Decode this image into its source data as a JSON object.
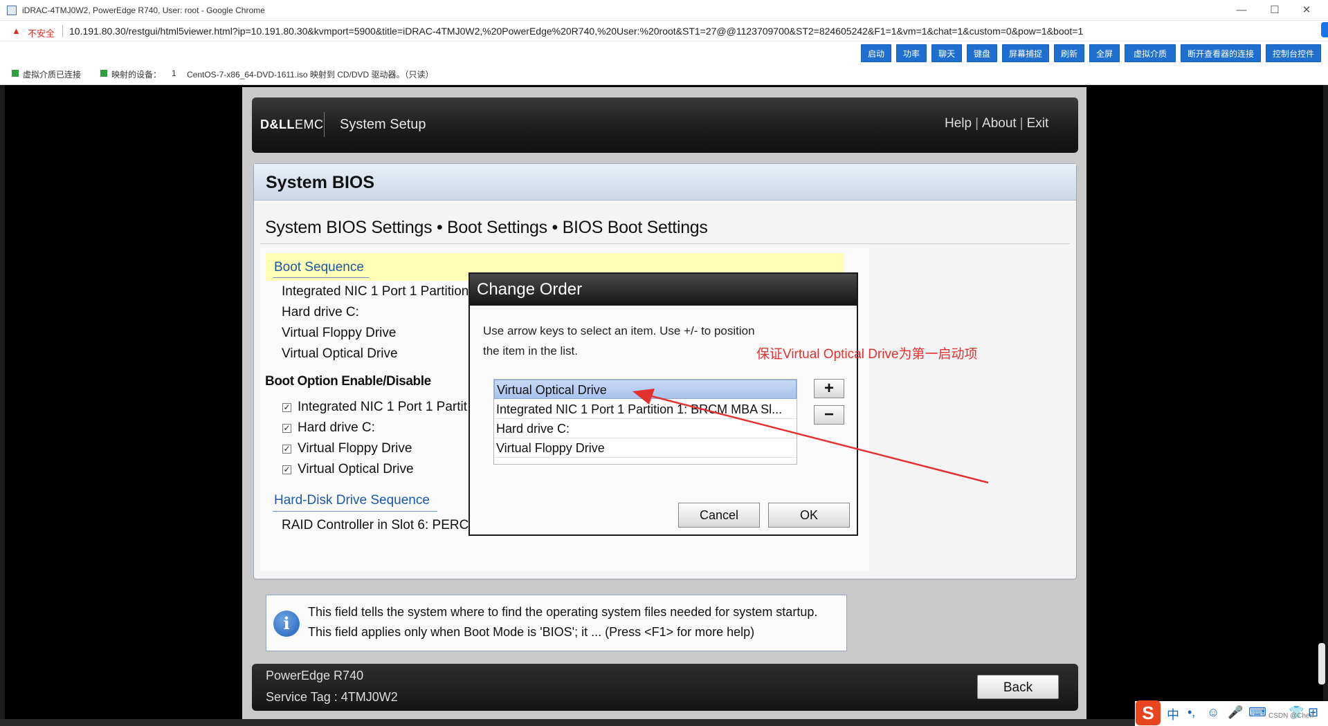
{
  "browser": {
    "window_title": "iDRAC-4TMJ0W2, PowerEdge R740, User: root - Google Chrome",
    "insecure_label": "不安全",
    "url": "10.191.80.30/restgui/html5viewer.html?ip=10.191.80.30&kvmport=5900&title=iDRAC-4TMJ0W2,%20PowerEdge%20R740,%20User:%20root&ST1=27@@1123709700&ST2=824605242&F1=1&vm=1&chat=1&custom=0&pow=1&boot=1",
    "minimize": "—",
    "maximize": "☐",
    "close": "✕"
  },
  "toolbar": {
    "buttons": [
      "启动",
      "功率",
      "聊天",
      "键盘",
      "屏幕捕捉",
      "刷新",
      "全屏",
      "虚拟介质",
      "断开查看器的连接",
      "控制台控件"
    ]
  },
  "status": {
    "vm_connected": "虚拟介质已连接",
    "mapped_label": "映射的设备：",
    "mapped_count": "1",
    "mapped_detail": "CentOS-7-x86_64-DVD-1611.iso 映射到 CD/DVD 驱动器。（只读）",
    "accent": "#2e9e3e"
  },
  "header": {
    "logo_bold": "D&LL",
    "logo_light": "EMC",
    "title": "System Setup",
    "links": [
      "Help",
      "About",
      "Exit"
    ]
  },
  "page": {
    "title": "System BIOS",
    "breadcrumb": "System BIOS Settings • Boot Settings • BIOS Boot Settings"
  },
  "boot_sequence": {
    "label": "Boot Sequence",
    "items": [
      "Integrated NIC 1 Port 1 Partition",
      "Hard drive C:",
      "Virtual Floppy Drive",
      "Virtual Optical Drive"
    ]
  },
  "boot_option": {
    "title": "Boot Option Enable/Disable",
    "items": [
      {
        "label": "Integrated NIC 1 Port 1 Partit",
        "checked": true
      },
      {
        "label": "Hard drive C:",
        "checked": true
      },
      {
        "label": "Virtual Floppy Drive",
        "checked": true
      },
      {
        "label": "Virtual Optical Drive",
        "checked": true
      }
    ]
  },
  "hdd_sequence": {
    "label": "Hard-Disk Drive Sequence",
    "item": "RAID Controller in Slot 6: PERC"
  },
  "help": {
    "icon": "i",
    "text": "This field tells the system where to find the operating system files needed for system startup. This field applies only when Boot Mode is 'BIOS'; it ... (Press <F1> for more help)"
  },
  "footer": {
    "model": "PowerEdge R740",
    "service_tag": "Service Tag : 4TMJ0W2",
    "back_label": "Back"
  },
  "dialog": {
    "title": "Change Order",
    "instructions": "Use arrow keys to select an item. Use +/- to position the item in the list.",
    "items": [
      "Virtual Optical Drive",
      "Integrated NIC 1 Port 1 Partition 1: BRCM MBA Sl...",
      "Hard drive C:",
      "Virtual Floppy Drive"
    ],
    "selected_index": 0,
    "plus": "+",
    "minus": "−",
    "cancel_label": "Cancel",
    "ok_label": "OK"
  },
  "annotation": {
    "text": "保证Virtual Optical Drive为第一启动项",
    "color": "#e53030"
  },
  "tray": {
    "ime_logo": "S",
    "glyphs": [
      "中",
      "•,",
      "☺",
      "🎤",
      "⌨",
      "👕",
      "⊞"
    ],
    "watermark": "CSDN @Chen"
  }
}
